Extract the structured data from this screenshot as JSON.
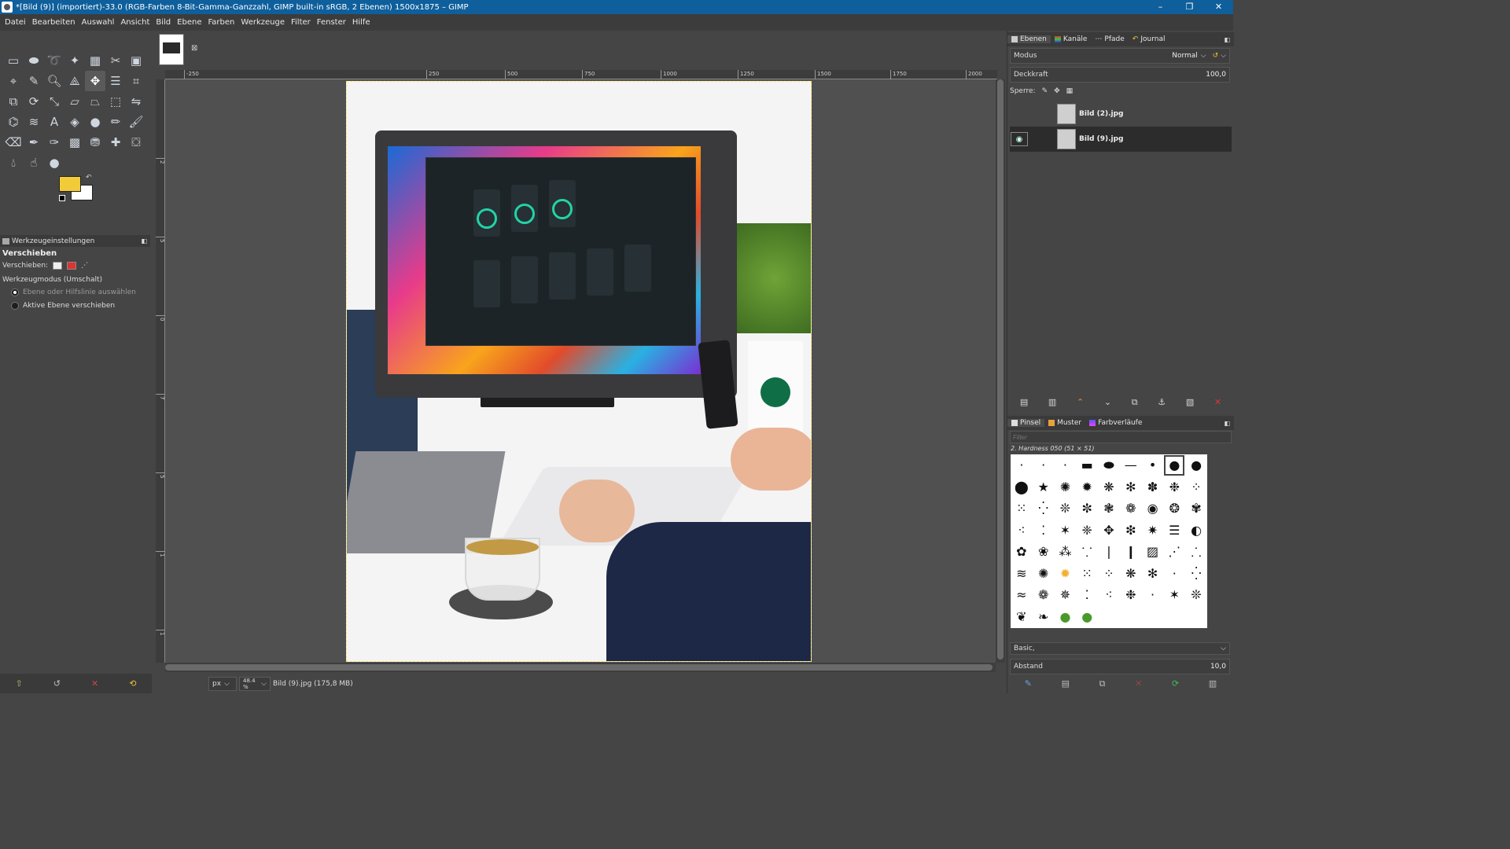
{
  "window": {
    "title": "*[Bild (9)] (importiert)-33.0 (RGB-Farben 8-Bit-Gamma-Ganzzahl, GIMP built-in sRGB, 2 Ebenen) 1500x1875 – GIMP"
  },
  "menu": [
    "Datei",
    "Bearbeiten",
    "Auswahl",
    "Ansicht",
    "Bild",
    "Ebene",
    "Farben",
    "Werkzeuge",
    "Filter",
    "Fenster",
    "Hilfe"
  ],
  "colors": {
    "foreground": "#f2cb38",
    "background": "#ffffff",
    "titlebar": "#0e5f9c"
  },
  "tool_options": {
    "tab_label": "Werkzeugeinstellungen",
    "tool_name": "Verschieben",
    "move_label": "Verschieben:",
    "mode_label": "Werkzeugmodus (Umschalt)",
    "option1": "Ebene oder Hilfslinie auswählen",
    "option2": "Aktive Ebene verschieben"
  },
  "ruler_h": [
    "-250",
    "250",
    "500",
    "750",
    "1000",
    "1250",
    "1500",
    "1750",
    "2000"
  ],
  "ruler_v": [
    "2",
    "5",
    "0",
    "7",
    "5",
    "1",
    "1",
    "1",
    "5",
    "1",
    "7"
  ],
  "status": {
    "unit": "px",
    "zoom": "48.4 %",
    "info": "Bild (9).jpg (175,8 MB)"
  },
  "layers_panel": {
    "tabs": [
      "Ebenen",
      "Kanäle",
      "Pfade",
      "Journal"
    ],
    "mode_label": "Modus",
    "mode_value": "Normal",
    "opacity_label": "Deckkraft",
    "opacity_value": "100,0",
    "lock_label": "Sperre:",
    "layers": [
      {
        "name": "Bild (2).jpg",
        "visible": false
      },
      {
        "name": "Bild (9).jpg",
        "visible": true
      }
    ]
  },
  "brushes_panel": {
    "tabs": [
      "Pinsel",
      "Muster",
      "Farbverläufe"
    ],
    "filter_placeholder": "Filter",
    "brush_name": "2. Hardness 050 (51 × 51)",
    "tag_value": "Basic,",
    "spacing_label": "Abstand",
    "spacing_value": "10,0"
  }
}
